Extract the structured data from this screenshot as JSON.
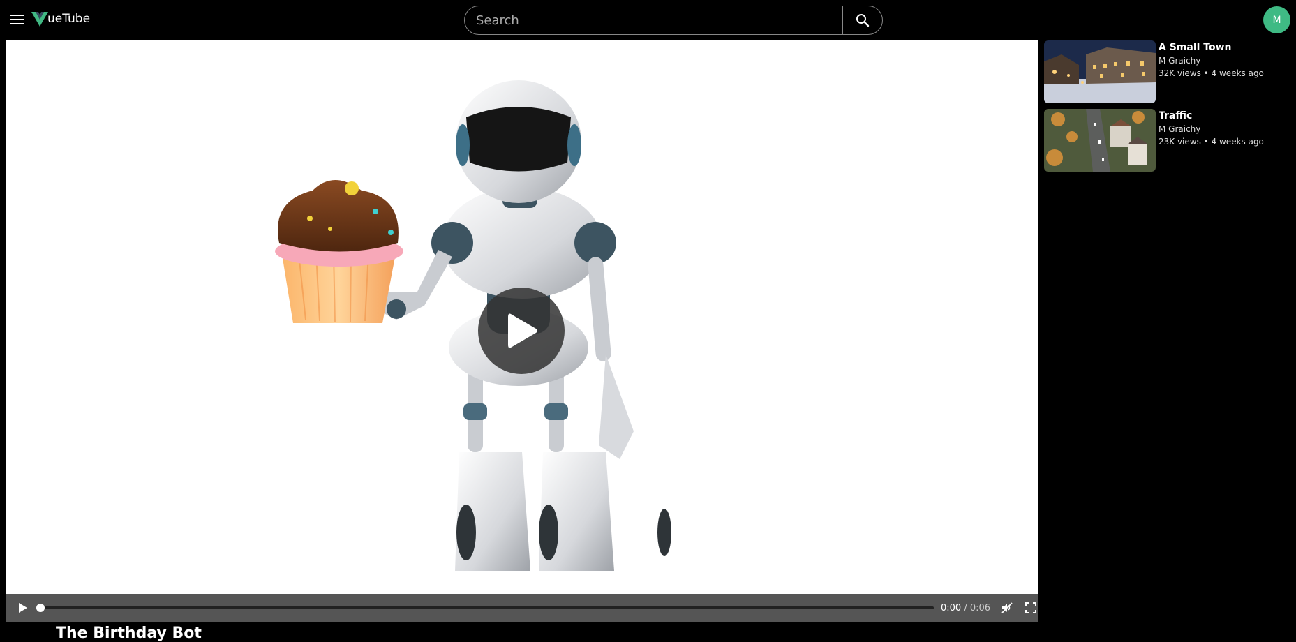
{
  "app": {
    "name": "VueTube",
    "logo_letter": "V",
    "logo_rest": "ueTube"
  },
  "search": {
    "placeholder": "Search"
  },
  "user": {
    "avatar_initial": "M",
    "avatar_color": "#3fba84"
  },
  "player": {
    "current_time": "0:00",
    "separator": " / ",
    "duration": "0:06",
    "progress": 0
  },
  "video": {
    "title": "The Birthday Bot"
  },
  "recommendations": [
    {
      "title": "A Small Town",
      "channel": "M Graichy",
      "meta": "32K views • 4 weeks ago"
    },
    {
      "title": "Traffic",
      "channel": "M Graichy",
      "meta": "23K views • 4 weeks ago"
    }
  ],
  "colors": {
    "accent": "#3fba84",
    "controls_bg": "#555555"
  }
}
